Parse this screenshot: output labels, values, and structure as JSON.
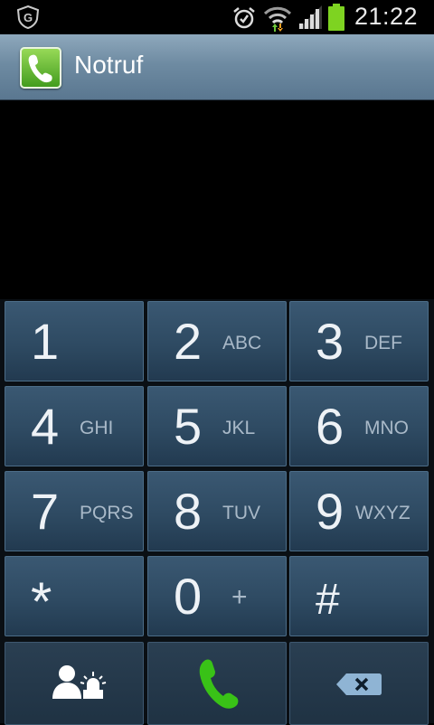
{
  "status_bar": {
    "time": "21:22",
    "icons": [
      "shield-g-icon",
      "alarm-icon",
      "wifi-icon",
      "signal-icon",
      "battery-icon"
    ],
    "battery_color": "#7ed321"
  },
  "app_bar": {
    "title": "Notruf",
    "icon": "phone-app-icon"
  },
  "keypad": {
    "keys": [
      {
        "digit": "1",
        "letters": ""
      },
      {
        "digit": "2",
        "letters": "ABC"
      },
      {
        "digit": "3",
        "letters": "DEF"
      },
      {
        "digit": "4",
        "letters": "GHI"
      },
      {
        "digit": "5",
        "letters": "JKL"
      },
      {
        "digit": "6",
        "letters": "MNO"
      },
      {
        "digit": "7",
        "letters": "PQRS"
      },
      {
        "digit": "8",
        "letters": "TUV"
      },
      {
        "digit": "9",
        "letters": "WXYZ"
      },
      {
        "digit": "*",
        "letters": ""
      },
      {
        "digit": "0",
        "letters": "+"
      },
      {
        "digit": "#",
        "letters": ""
      }
    ],
    "actions": [
      "emergency-contacts-icon",
      "call-icon",
      "backspace-icon"
    ]
  },
  "colors": {
    "key_top": "#3a5872",
    "key_bottom": "#223a50",
    "call_green": "#39c217",
    "action_bar": "#6e8ba2"
  }
}
